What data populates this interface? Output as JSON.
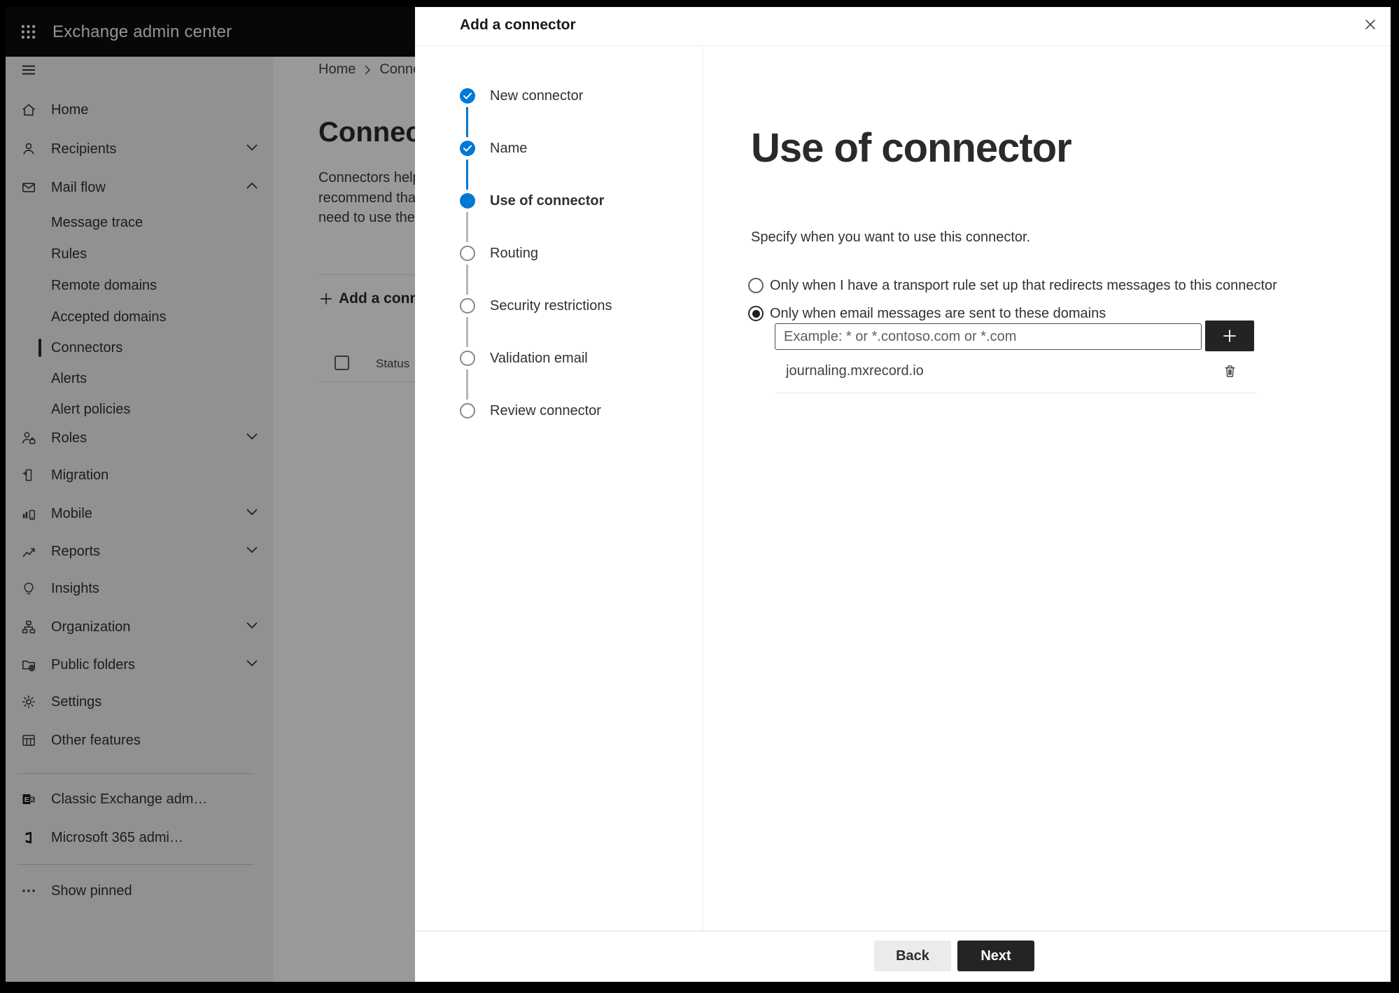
{
  "app_header": {
    "title": "Exchange admin center"
  },
  "sidebar": {
    "items": [
      {
        "label": "Home"
      },
      {
        "label": "Recipients",
        "chevron": "down"
      },
      {
        "label": "Mail flow",
        "chevron": "up",
        "expanded": true
      },
      {
        "label": "Message trace"
      },
      {
        "label": "Rules"
      },
      {
        "label": "Remote domains"
      },
      {
        "label": "Accepted domains"
      },
      {
        "label": "Connectors",
        "selected": true
      },
      {
        "label": "Alerts"
      },
      {
        "label": "Alert policies"
      },
      {
        "label": "Roles",
        "chevron": "down"
      },
      {
        "label": "Migration"
      },
      {
        "label": "Mobile",
        "chevron": "down"
      },
      {
        "label": "Reports",
        "chevron": "down"
      },
      {
        "label": "Insights"
      },
      {
        "label": "Organization",
        "chevron": "down"
      },
      {
        "label": "Public folders",
        "chevron": "down"
      },
      {
        "label": "Settings"
      },
      {
        "label": "Other features"
      },
      {
        "label": "Classic Exchange adm…"
      },
      {
        "label": "Microsoft 365 admi…"
      },
      {
        "label": "Show pinned"
      }
    ]
  },
  "page": {
    "breadcrumb": {
      "home": "Home",
      "current": "Connectors"
    },
    "title": "Connectors",
    "description_lines": [
      "Connectors help",
      "recommend that",
      "need to use ther"
    ],
    "add_button": "Add a connector",
    "table": {
      "status_header": "Status"
    }
  },
  "dialog": {
    "title": "Add a connector",
    "steps": [
      {
        "label": "New connector",
        "state": "completed"
      },
      {
        "label": "Name",
        "state": "completed"
      },
      {
        "label": "Use of connector",
        "state": "current"
      },
      {
        "label": "Routing",
        "state": "upcoming"
      },
      {
        "label": "Security restrictions",
        "state": "upcoming"
      },
      {
        "label": "Validation email",
        "state": "upcoming"
      },
      {
        "label": "Review connector",
        "state": "upcoming"
      }
    ],
    "content": {
      "heading": "Use of connector",
      "description": "Specify when you want to use this connector.",
      "options": [
        {
          "label": "Only when I have a transport rule set up that redirects messages to this connector",
          "selected": false
        },
        {
          "label": "Only when email messages are sent to these domains",
          "selected": true
        }
      ],
      "domain_input_placeholder": "Example: * or *.contoso.com or *.com",
      "domains": [
        "journaling.mxrecord.io"
      ]
    },
    "footer": {
      "back": "Back",
      "next": "Next"
    }
  },
  "colors": {
    "accent_blue": "#0078d4",
    "primary_dark": "#242424",
    "header_bg": "#0c0c0c",
    "sidebar_bg": "#f3f2f1",
    "text": "#323130"
  }
}
